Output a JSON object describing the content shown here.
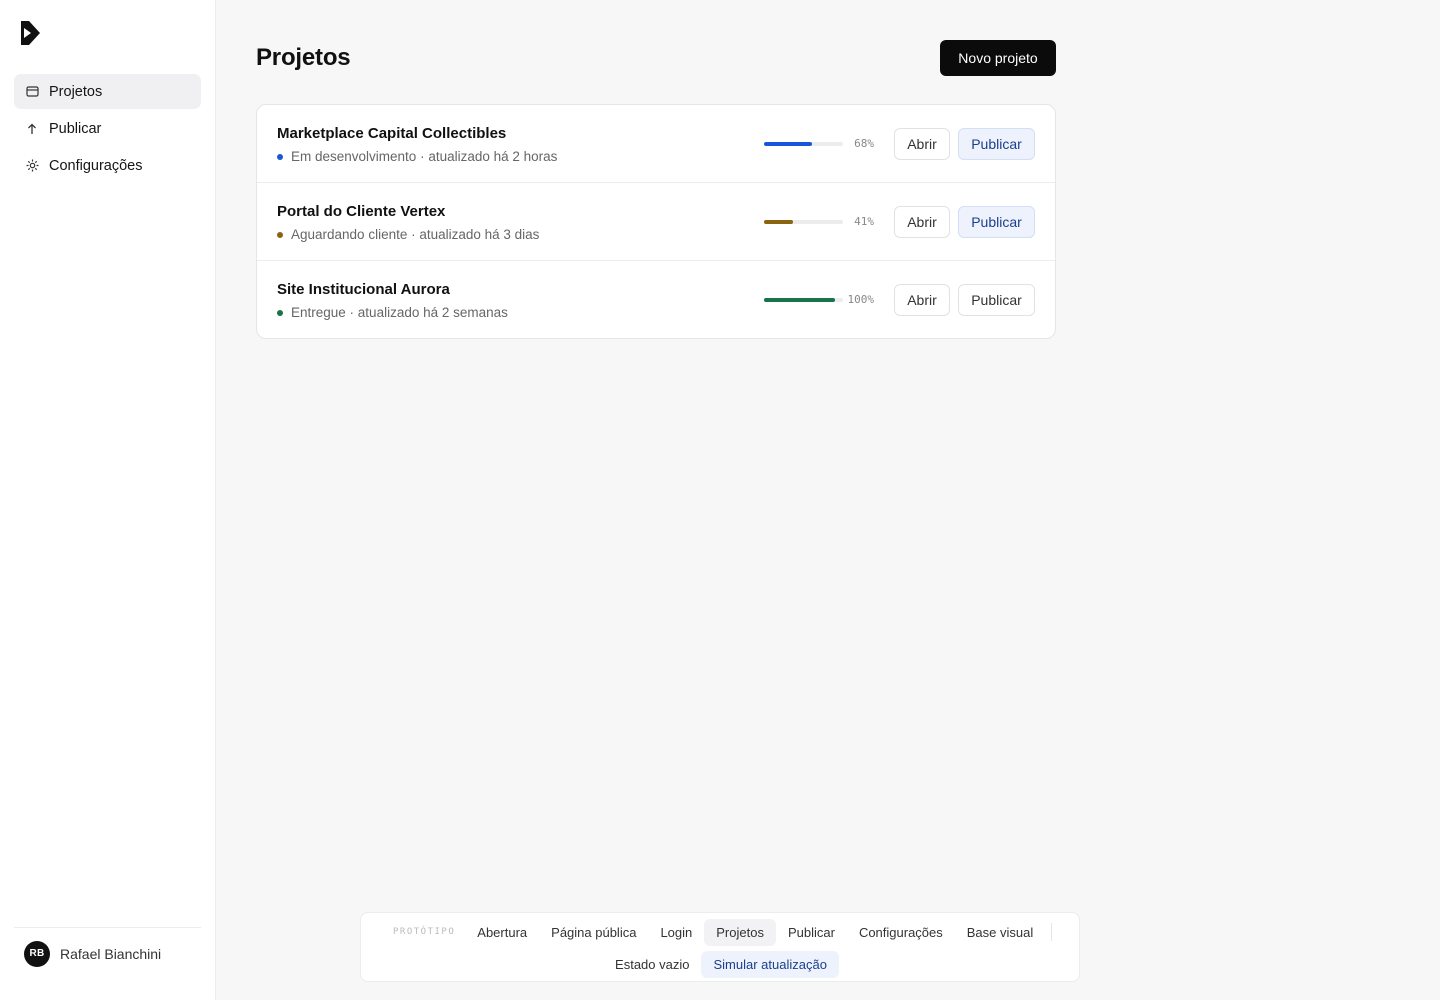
{
  "sidebar": {
    "items": [
      {
        "label": "Projetos",
        "icon": "folder-icon",
        "active": true
      },
      {
        "label": "Publicar",
        "icon": "arrow-up-icon",
        "active": false
      },
      {
        "label": "Configurações",
        "icon": "gear-icon",
        "active": false
      }
    ],
    "user": {
      "initials": "RB",
      "name": "Rafael Bianchini"
    }
  },
  "main": {
    "title": "Projetos",
    "new_button": "Novo projeto",
    "projects": [
      {
        "name": "Marketplace Capital Collectibles",
        "status": "Em desenvolvimento",
        "updated": "atualizado há 2 horas",
        "progress": 68,
        "progress_label": "68%",
        "color": "#1a56db",
        "open_label": "Abrir",
        "publish_label": "Publicar",
        "publish_highlight": true
      },
      {
        "name": "Portal do Cliente Vertex",
        "status": "Aguardando cliente",
        "updated": "atualizado há 3 dias",
        "progress": 41,
        "progress_label": "41%",
        "color": "#8a6410",
        "open_label": "Abrir",
        "publish_label": "Publicar",
        "publish_highlight": true
      },
      {
        "name": "Site Institucional Aurora",
        "status": "Entregue",
        "updated": "atualizado há 2 semanas",
        "progress": 100,
        "progress_label": "100%",
        "color": "#17734a",
        "open_label": "Abrir",
        "publish_label": "Publicar",
        "publish_highlight": false
      }
    ]
  },
  "prototype_bar": {
    "tag": "PROTÓTIPO",
    "row1": [
      "Abertura",
      "Página pública",
      "Login",
      "Projetos",
      "Publicar",
      "Configurações",
      "Base visual"
    ],
    "current": "Projetos",
    "row2": [
      "Estado vazio",
      "Simular atualização"
    ]
  }
}
